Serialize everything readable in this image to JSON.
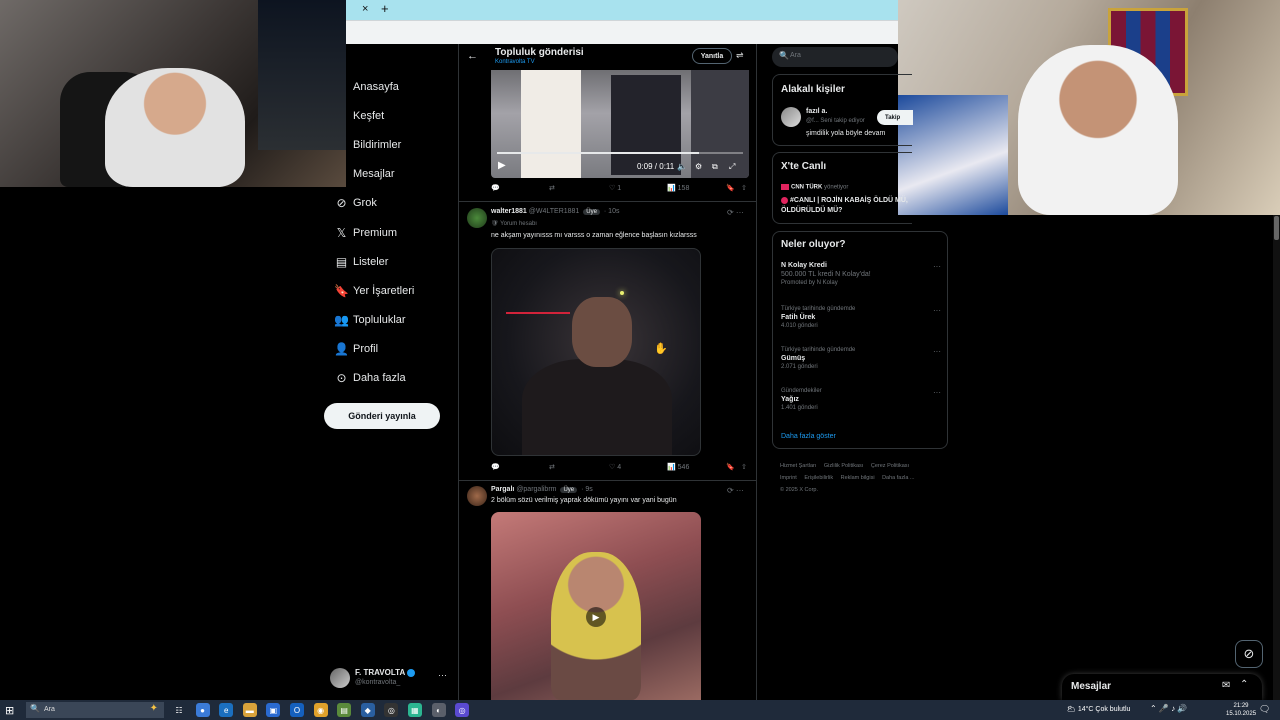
{
  "browser": {
    "tab_close": "×",
    "tab_new": "+"
  },
  "nav": {
    "items": [
      {
        "label": "Anasayfa",
        "icon": ""
      },
      {
        "label": "Keşfet",
        "icon": ""
      },
      {
        "label": "Bildirimler",
        "icon": ""
      },
      {
        "label": "Mesajlar",
        "icon": ""
      },
      {
        "label": "Grok",
        "icon": "⊘"
      },
      {
        "label": "Premium",
        "icon": "𝕏"
      },
      {
        "label": "Listeler",
        "icon": "▤"
      },
      {
        "label": "Yer İşaretleri",
        "icon": "🔖"
      },
      {
        "label": "Topluluklar",
        "icon": "👥"
      },
      {
        "label": "Profil",
        "icon": "👤"
      },
      {
        "label": "Daha fazla",
        "icon": "⊙"
      }
    ],
    "post_button": "Gönderi yayınla",
    "account": {
      "name": "F. TRAVOLTA",
      "handle": "@kontravolta_",
      "more": "···"
    }
  },
  "header": {
    "back": "←",
    "title": "Topluluk gönderisi",
    "subtitle": "Kontravolta TV",
    "reply_button": "Yanıtla",
    "settings_icon": "⇌"
  },
  "video1": {
    "play": "▶",
    "time": "0:09 / 0:11",
    "progress": 0.82,
    "volume_icon": "🔈",
    "settings_icon": "⚙",
    "pip_icon": "⧉",
    "fullscreen_icon": "⤢"
  },
  "post1_actions": {
    "reply": "💬",
    "retweet": "⇄",
    "like": "♡ 1",
    "views": "📊 158",
    "bookmark": "🔖",
    "share": "⇧"
  },
  "post2": {
    "name": "walter1881",
    "handle": "@W4LTER1881",
    "badge": "Üye",
    "time": "· 10s",
    "sub": "🛡 Yorum hesabı",
    "text": "ne akşam yayınısss mı varsss o zaman eğlence başlasın kızlarsss",
    "actions": {
      "reply": "💬",
      "retweet": "⇄",
      "like": "♡ 4",
      "views": "📊 546",
      "bookmark": "🔖",
      "share": "⇧"
    },
    "icons": "⟳ ···"
  },
  "post3": {
    "name": "Pargalı",
    "handle": "@pargalibrm",
    "badge": "Üye",
    "time": "· 9s",
    "text": "2 bölüm sözü verilmiş yaprak dökümü yayını var yani bugün",
    "icons": "⟳ ···",
    "play": "▶"
  },
  "right": {
    "search_placeholder": "Ara",
    "search_icon": "🔍",
    "related": {
      "title": "Alakalı kişiler",
      "name": "fazıl a.",
      "handle": "@f... Seni takip ediyor",
      "bio": "şimdilik yola böyle devam",
      "follow": "Takip"
    },
    "live": {
      "title": "X'te Canlı",
      "source": "CNN TÜRK",
      "source_suffix": "yönetiyor",
      "headline": "#CANLI | ROJİN KABAİŞ ÖLDÜ MÜ, ÖLDÜRÜLDÜ MÜ?"
    },
    "trends": {
      "title": "Neler oluyor?",
      "items": [
        {
          "context": "",
          "topic": "N Kolay Kredi",
          "desc": "500.000 TL kredi N Kolay'da!",
          "meta": "Promoted by N Kolay"
        },
        {
          "context": "Türkiye tarihinde gündemde",
          "topic": "Fatih Ürek",
          "desc": "",
          "meta": "4.010 gönderi"
        },
        {
          "context": "Türkiye tarihinde gündemde",
          "topic": "Gümüş",
          "desc": "",
          "meta": "2.071 gönderi"
        },
        {
          "context": "Gündemdekiler",
          "topic": "Yağız",
          "desc": "",
          "meta": "1.401 gönderi"
        }
      ],
      "more": "···",
      "show_more": "Daha fazla göster"
    },
    "footer": [
      "Hizmet Şartları",
      "Gizlilik Politikası",
      "Çerez Politikası",
      "Imprint",
      "Erişilebilirlik",
      "Reklam bilgisi",
      "Daha fazla ...",
      "© 2025 X Corp."
    ]
  },
  "messages_drawer": {
    "title": "Mesajlar",
    "compose_icon": "✉",
    "expand_icon": "⌃"
  },
  "grok_fab": "⊘",
  "taskbar": {
    "start": "⊞",
    "search_placeholder": "Ara",
    "search_icon": "🔍",
    "sparkle": "✦",
    "weather": "🌥 14°C  Çok bulutlu",
    "tray": "⌃ 🎤 ♪ 🔊",
    "time": "21:29",
    "date": "15.10.2025",
    "notif": "🗨",
    "apps": [
      {
        "glyph": "☷",
        "color": "#1f2a3a"
      },
      {
        "glyph": "●",
        "color": "#3b7bd8"
      },
      {
        "glyph": "e",
        "color": "#1b6fbf"
      },
      {
        "glyph": "▬",
        "color": "#d8a23b"
      },
      {
        "glyph": "▣",
        "color": "#2a6ad0"
      },
      {
        "glyph": "O",
        "color": "#1560bd"
      },
      {
        "glyph": "◉",
        "color": "#e0a12b"
      },
      {
        "glyph": "▤",
        "color": "#5a8a3b"
      },
      {
        "glyph": "◆",
        "color": "#2a5fa0"
      },
      {
        "glyph": "◎",
        "color": "#333"
      },
      {
        "glyph": "▦",
        "color": "#2cb591"
      },
      {
        "glyph": "◐",
        "color": "#5a5f6a"
      },
      {
        "glyph": "◎",
        "color": "#5a4ad0"
      }
    ]
  }
}
